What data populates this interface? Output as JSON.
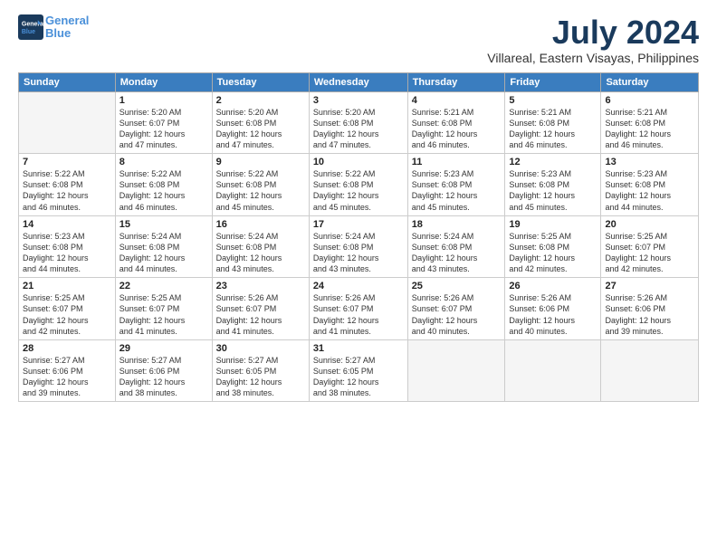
{
  "header": {
    "logo_line1": "General",
    "logo_line2": "Blue",
    "title": "July 2024",
    "subtitle": "Villareal, Eastern Visayas, Philippines"
  },
  "weekdays": [
    "Sunday",
    "Monday",
    "Tuesday",
    "Wednesday",
    "Thursday",
    "Friday",
    "Saturday"
  ],
  "weeks": [
    [
      {
        "day": "",
        "info": ""
      },
      {
        "day": "1",
        "info": "Sunrise: 5:20 AM\nSunset: 6:07 PM\nDaylight: 12 hours\nand 47 minutes."
      },
      {
        "day": "2",
        "info": "Sunrise: 5:20 AM\nSunset: 6:08 PM\nDaylight: 12 hours\nand 47 minutes."
      },
      {
        "day": "3",
        "info": "Sunrise: 5:20 AM\nSunset: 6:08 PM\nDaylight: 12 hours\nand 47 minutes."
      },
      {
        "day": "4",
        "info": "Sunrise: 5:21 AM\nSunset: 6:08 PM\nDaylight: 12 hours\nand 46 minutes."
      },
      {
        "day": "5",
        "info": "Sunrise: 5:21 AM\nSunset: 6:08 PM\nDaylight: 12 hours\nand 46 minutes."
      },
      {
        "day": "6",
        "info": "Sunrise: 5:21 AM\nSunset: 6:08 PM\nDaylight: 12 hours\nand 46 minutes."
      }
    ],
    [
      {
        "day": "7",
        "info": "Sunrise: 5:22 AM\nSunset: 6:08 PM\nDaylight: 12 hours\nand 46 minutes."
      },
      {
        "day": "8",
        "info": "Sunrise: 5:22 AM\nSunset: 6:08 PM\nDaylight: 12 hours\nand 46 minutes."
      },
      {
        "day": "9",
        "info": "Sunrise: 5:22 AM\nSunset: 6:08 PM\nDaylight: 12 hours\nand 45 minutes."
      },
      {
        "day": "10",
        "info": "Sunrise: 5:22 AM\nSunset: 6:08 PM\nDaylight: 12 hours\nand 45 minutes."
      },
      {
        "day": "11",
        "info": "Sunrise: 5:23 AM\nSunset: 6:08 PM\nDaylight: 12 hours\nand 45 minutes."
      },
      {
        "day": "12",
        "info": "Sunrise: 5:23 AM\nSunset: 6:08 PM\nDaylight: 12 hours\nand 45 minutes."
      },
      {
        "day": "13",
        "info": "Sunrise: 5:23 AM\nSunset: 6:08 PM\nDaylight: 12 hours\nand 44 minutes."
      }
    ],
    [
      {
        "day": "14",
        "info": "Sunrise: 5:23 AM\nSunset: 6:08 PM\nDaylight: 12 hours\nand 44 minutes."
      },
      {
        "day": "15",
        "info": "Sunrise: 5:24 AM\nSunset: 6:08 PM\nDaylight: 12 hours\nand 44 minutes."
      },
      {
        "day": "16",
        "info": "Sunrise: 5:24 AM\nSunset: 6:08 PM\nDaylight: 12 hours\nand 43 minutes."
      },
      {
        "day": "17",
        "info": "Sunrise: 5:24 AM\nSunset: 6:08 PM\nDaylight: 12 hours\nand 43 minutes."
      },
      {
        "day": "18",
        "info": "Sunrise: 5:24 AM\nSunset: 6:08 PM\nDaylight: 12 hours\nand 43 minutes."
      },
      {
        "day": "19",
        "info": "Sunrise: 5:25 AM\nSunset: 6:08 PM\nDaylight: 12 hours\nand 42 minutes."
      },
      {
        "day": "20",
        "info": "Sunrise: 5:25 AM\nSunset: 6:07 PM\nDaylight: 12 hours\nand 42 minutes."
      }
    ],
    [
      {
        "day": "21",
        "info": "Sunrise: 5:25 AM\nSunset: 6:07 PM\nDaylight: 12 hours\nand 42 minutes."
      },
      {
        "day": "22",
        "info": "Sunrise: 5:25 AM\nSunset: 6:07 PM\nDaylight: 12 hours\nand 41 minutes."
      },
      {
        "day": "23",
        "info": "Sunrise: 5:26 AM\nSunset: 6:07 PM\nDaylight: 12 hours\nand 41 minutes."
      },
      {
        "day": "24",
        "info": "Sunrise: 5:26 AM\nSunset: 6:07 PM\nDaylight: 12 hours\nand 41 minutes."
      },
      {
        "day": "25",
        "info": "Sunrise: 5:26 AM\nSunset: 6:07 PM\nDaylight: 12 hours\nand 40 minutes."
      },
      {
        "day": "26",
        "info": "Sunrise: 5:26 AM\nSunset: 6:06 PM\nDaylight: 12 hours\nand 40 minutes."
      },
      {
        "day": "27",
        "info": "Sunrise: 5:26 AM\nSunset: 6:06 PM\nDaylight: 12 hours\nand 39 minutes."
      }
    ],
    [
      {
        "day": "28",
        "info": "Sunrise: 5:27 AM\nSunset: 6:06 PM\nDaylight: 12 hours\nand 39 minutes."
      },
      {
        "day": "29",
        "info": "Sunrise: 5:27 AM\nSunset: 6:06 PM\nDaylight: 12 hours\nand 38 minutes."
      },
      {
        "day": "30",
        "info": "Sunrise: 5:27 AM\nSunset: 6:05 PM\nDaylight: 12 hours\nand 38 minutes."
      },
      {
        "day": "31",
        "info": "Sunrise: 5:27 AM\nSunset: 6:05 PM\nDaylight: 12 hours\nand 38 minutes."
      },
      {
        "day": "",
        "info": ""
      },
      {
        "day": "",
        "info": ""
      },
      {
        "day": "",
        "info": ""
      }
    ]
  ]
}
